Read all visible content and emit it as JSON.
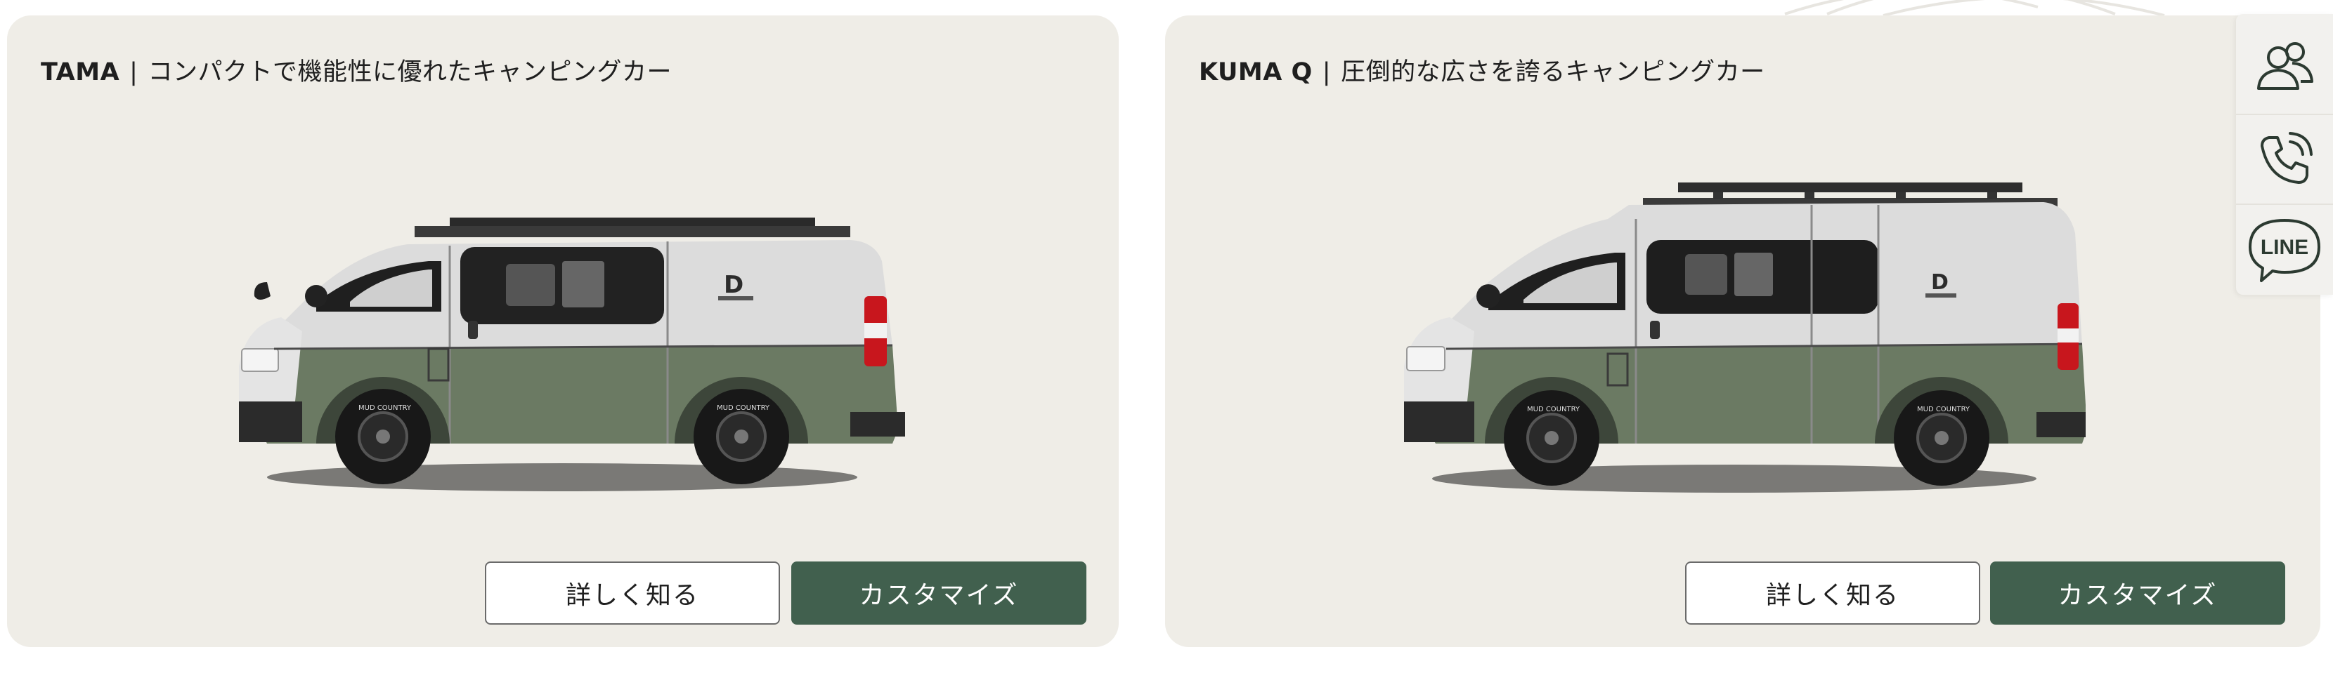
{
  "cards": [
    {
      "model": "TAMA",
      "separator": "|",
      "tagline": "コンパクトで機能性に優れたキャンピングカー",
      "details_label": "詳しく知る",
      "customize_label": "カスタマイズ",
      "van_logo": "D",
      "tire_text": "MUD COUNTRY"
    },
    {
      "model": "KUMA Q",
      "separator": "|",
      "tagline": "圧倒的な広さを誇るキャンピングカー",
      "details_label": "詳しく知る",
      "customize_label": "カスタマイズ",
      "van_logo": "D",
      "tire_text": "MUD COUNTRY"
    }
  ],
  "side_dock": {
    "items": [
      {
        "icon": "users-icon"
      },
      {
        "icon": "phone-icon"
      },
      {
        "icon": "line-icon",
        "label": "LINE"
      }
    ]
  },
  "colors": {
    "card_bg": "#efede7",
    "accent_green": "#41604e",
    "van_green": "#6b7a63",
    "van_white": "#d9d9d9"
  }
}
